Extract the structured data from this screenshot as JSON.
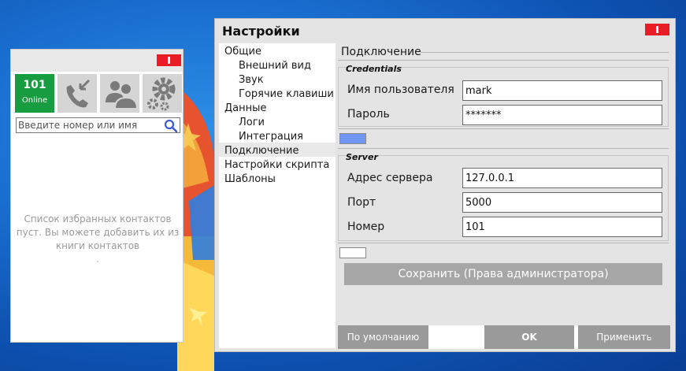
{
  "phone": {
    "status": {
      "number": "101",
      "text": "Online",
      "color": "#179c3f"
    },
    "tiles": [
      {
        "icon": "phone-arrow-icon"
      },
      {
        "icon": "contacts-icon"
      },
      {
        "icon": "gear-icon"
      }
    ],
    "search": {
      "placeholder": "Введите номер или имя",
      "icon": "search-icon"
    },
    "empty_line1": "Список избранных контактов",
    "empty_line2": "пуст. Вы можете добавить их из",
    "empty_line3": "книги контактов",
    "empty_line4": "."
  },
  "settings": {
    "title": "Настройки",
    "close_color": "#e81d25",
    "nav": [
      {
        "label": "Общие",
        "level": 1
      },
      {
        "label": "Внешний вид",
        "level": 2
      },
      {
        "label": "Звук",
        "level": 2
      },
      {
        "label": "Горячие клавиши",
        "level": 2
      },
      {
        "label": "Данные",
        "level": 1
      },
      {
        "label": "Логи",
        "level": 2
      },
      {
        "label": "Интеграция",
        "level": 2
      },
      {
        "label": "Подключение",
        "level": 1,
        "selected": true
      },
      {
        "label": "Настройки скрипта",
        "level": 1
      },
      {
        "label": "Шаблоны",
        "level": 1
      }
    ],
    "section_title": "Подключение",
    "credentials": {
      "title": "Credentials",
      "username_label": "Имя пользователя",
      "username_value": "mark",
      "password_label": "Пароль",
      "password_value": "*******"
    },
    "swatch1_color": "#6f96f5",
    "server": {
      "title": "Server",
      "address_label": "Адрес сервера",
      "address_value": "127.0.0.1",
      "port_label": "Порт",
      "port_value": "5000",
      "number_label": "Номер",
      "number_value": "101"
    },
    "swatch2_color": "#ffffff",
    "save_button": "Сохранить (Права администратора)",
    "buttons": {
      "default": "По умолчанию",
      "ok": "OK",
      "apply": "Применить"
    }
  }
}
